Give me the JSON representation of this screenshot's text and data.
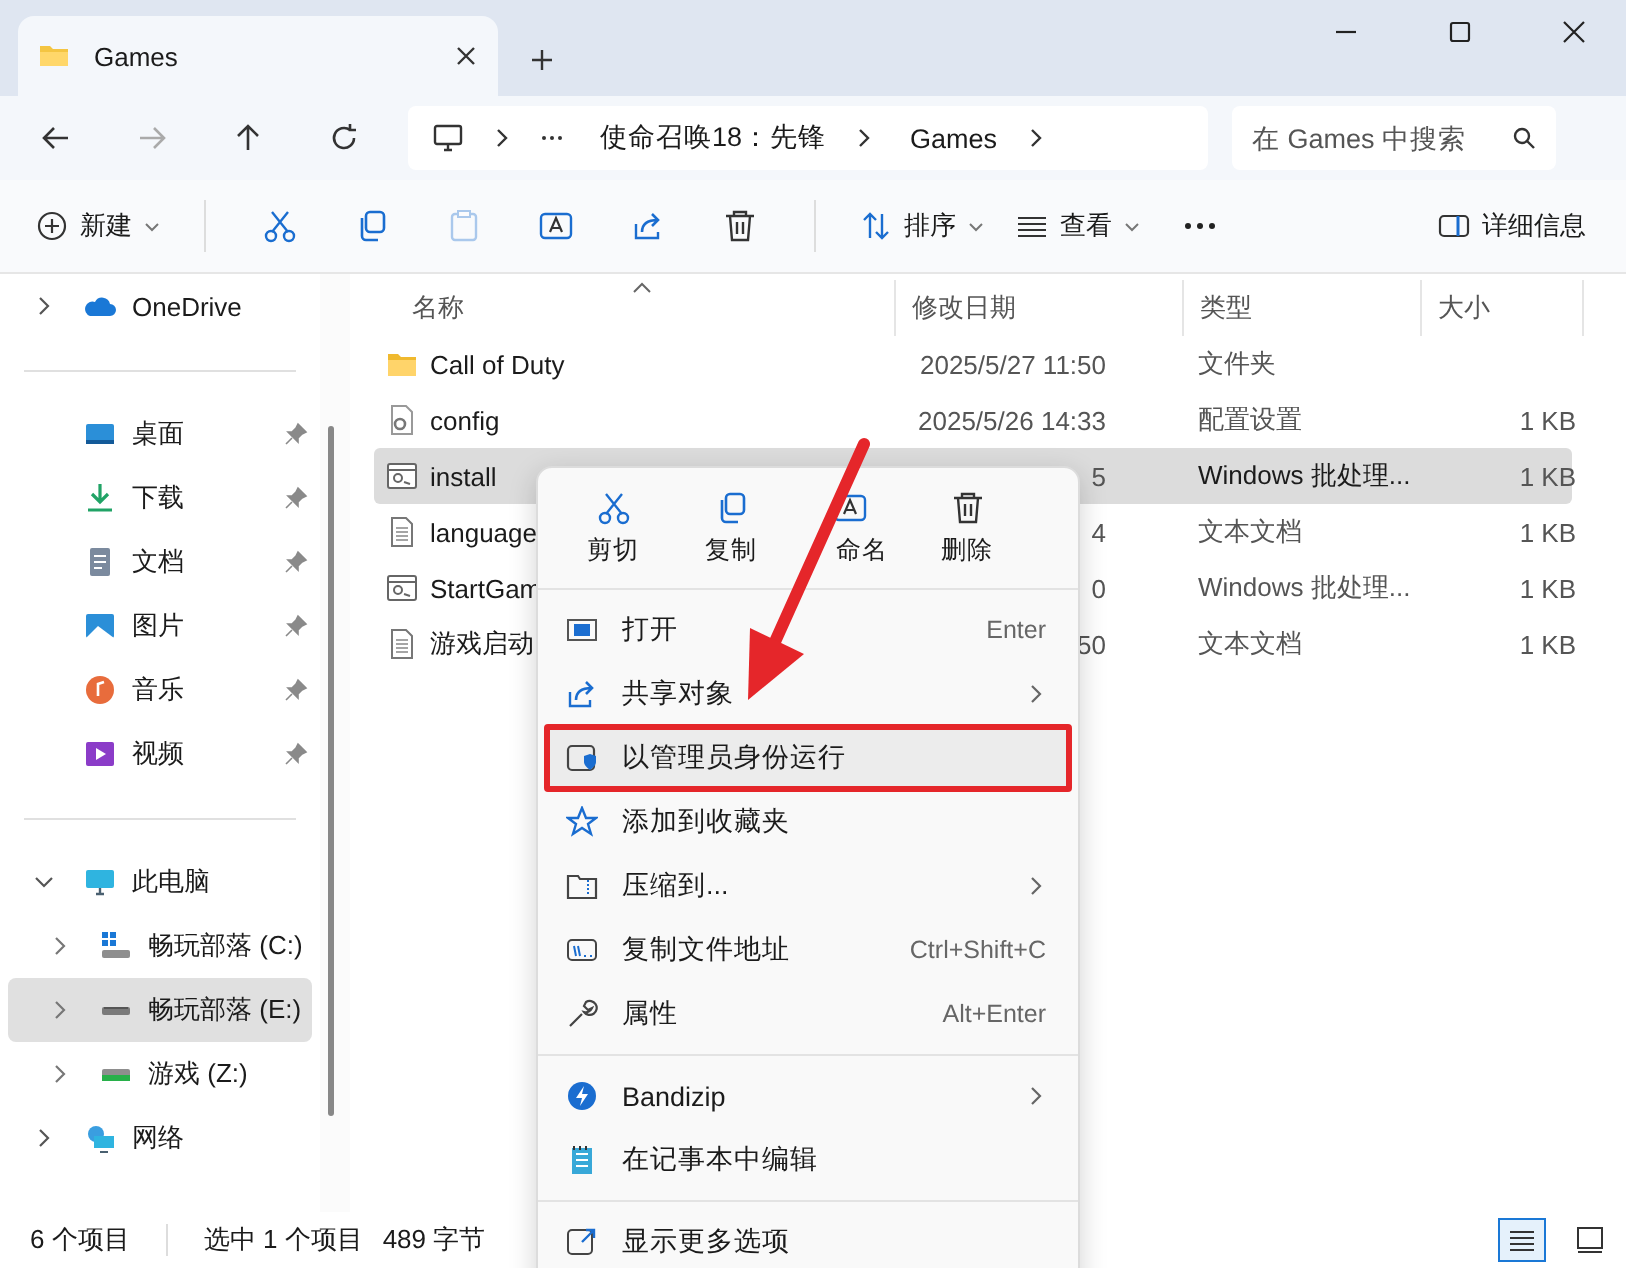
{
  "window": {
    "tab_title": "Games"
  },
  "address": {
    "path": [
      "使命召唤18：先锋",
      "Games"
    ],
    "search": {
      "placeholder": "在 Games 中搜索"
    }
  },
  "toolbar": {
    "new_label": "新建",
    "sort_label": "排序",
    "view_label": "查看",
    "details_label": "详细信息",
    "paste_disabled": true
  },
  "sidebar": {
    "sections": [
      [
        {
          "label": "OneDrive",
          "expanded": false,
          "selected": false
        }
      ],
      [
        {
          "label": "桌面",
          "pinned": true,
          "selected": false
        },
        {
          "label": "下载",
          "pinned": true,
          "selected": false
        },
        {
          "label": "文档",
          "pinned": true,
          "selected": false
        },
        {
          "label": "图片",
          "pinned": true,
          "selected": false
        },
        {
          "label": "音乐",
          "pinned": true,
          "selected": false
        },
        {
          "label": "视频",
          "pinned": true,
          "selected": false
        }
      ],
      [
        {
          "label": "此电脑",
          "expanded": true,
          "selected": false,
          "children": [
            {
              "label": "畅玩部落 (C:)",
              "expanded": false,
              "selected": false
            },
            {
              "label": "畅玩部落 (E:)",
              "expanded": false,
              "selected": true
            },
            {
              "label": "游戏 (Z:)",
              "expanded": false,
              "selected": false
            }
          ]
        },
        {
          "label": "网络",
          "expanded": false,
          "selected": false
        }
      ]
    ]
  },
  "table": {
    "columns": [
      "名称",
      "修改日期",
      "类型",
      "大小"
    ],
    "rows": [
      {
        "kind": "folder",
        "name": "Call of Duty",
        "date": "2025/5/27 11:50",
        "type": "文件夹",
        "selected": false
      },
      {
        "kind": "config",
        "name": "config",
        "date": "2025/5/26 14:33",
        "type": "配置设置",
        "size": "1 KB",
        "selected": false
      },
      {
        "kind": "batch",
        "name": "install",
        "date": "5",
        "type": "Windows 批处理...",
        "size": "1 KB",
        "selected": true
      },
      {
        "kind": "text",
        "name": "language",
        "date": "4",
        "type": "文本文档",
        "size": "1 KB",
        "selected": false
      },
      {
        "kind": "batch",
        "name": "StartGam",
        "date": "0",
        "type": "Windows 批处理...",
        "size": "1 KB",
        "selected": false
      },
      {
        "kind": "text",
        "name": "游戏启动",
        "date": "50",
        "type": "文本文档",
        "size": "1 KB",
        "selected": false
      }
    ]
  },
  "context_menu": {
    "quick_actions": [
      "剪切",
      "复制",
      "命名",
      "删除"
    ],
    "groups": [
      [
        {
          "label": "打开",
          "shortcut": "Enter",
          "submenu": false,
          "highlighted": false
        },
        {
          "label": "共享对象",
          "submenu": true,
          "highlighted": false
        },
        {
          "label": "以管理员身份运行",
          "submenu": false,
          "highlighted": true
        },
        {
          "label": "添加到收藏夹",
          "submenu": false,
          "highlighted": false
        },
        {
          "label": "压缩到...",
          "submenu": true,
          "highlighted": false
        },
        {
          "label": "复制文件地址",
          "shortcut": "Ctrl+Shift+C",
          "submenu": false,
          "highlighted": false
        },
        {
          "label": "属性",
          "shortcut": "Alt+Enter",
          "submenu": false,
          "highlighted": false
        }
      ],
      [
        {
          "label": "Bandizip",
          "submenu": true,
          "highlighted": false
        },
        {
          "label": "在记事本中编辑",
          "submenu": false,
          "highlighted": false
        }
      ],
      [
        {
          "label": "显示更多选项",
          "submenu": false,
          "highlighted": false
        }
      ]
    ]
  },
  "status_bar": {
    "count": "6 个项目",
    "selection": "选中 1 个项目",
    "size": "489 字节",
    "views": [
      {
        "selected": true
      },
      {
        "selected": false
      }
    ]
  }
}
